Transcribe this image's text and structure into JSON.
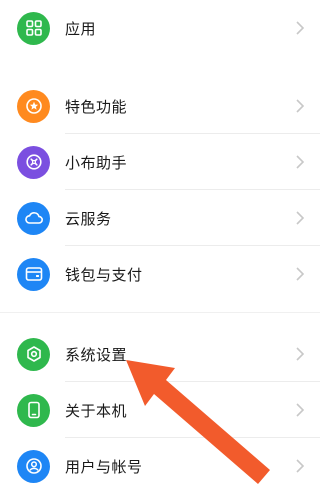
{
  "colors": {
    "green": "#2fb84d",
    "orange": "#ff8a1f",
    "purple": "#7b4fe0",
    "blue": "#1e86f5",
    "annotation_arrow": "#f25b2c"
  },
  "menu": {
    "items": [
      {
        "label": "应用",
        "icon": "apps-grid-icon"
      },
      {
        "label": "特色功能",
        "icon": "star-badge-icon"
      },
      {
        "label": "小布助手",
        "icon": "assistant-icon"
      },
      {
        "label": "云服务",
        "icon": "cloud-icon"
      },
      {
        "label": "钱包与支付",
        "icon": "wallet-icon"
      },
      {
        "label": "系统设置",
        "icon": "settings-hexagon-icon"
      },
      {
        "label": "关于本机",
        "icon": "phone-icon"
      },
      {
        "label": "用户与帐号",
        "icon": "user-account-icon"
      }
    ]
  }
}
